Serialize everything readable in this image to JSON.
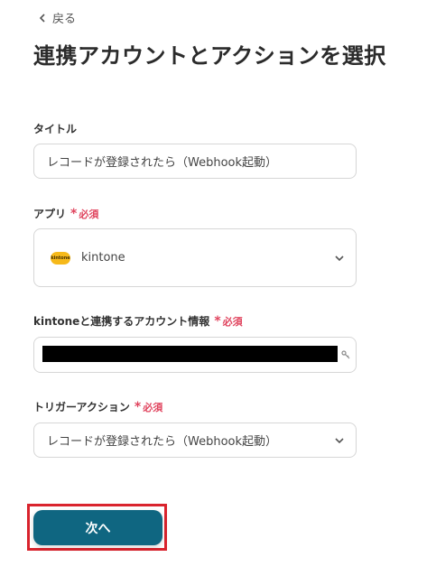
{
  "nav": {
    "back_label": "戻る"
  },
  "page": {
    "title": "連携アカウントとアクションを選択"
  },
  "fields": {
    "title": {
      "label": "タイトル",
      "value": "レコードが登録されたら（Webhook起動）"
    },
    "app": {
      "label": "アプリ",
      "required": "必須",
      "value": "kintone",
      "logo_text": "kintone"
    },
    "account": {
      "label": "kintoneと連携するアカウント情報",
      "required": "必須"
    },
    "trigger": {
      "label": "トリガーアクション",
      "required": "必須",
      "value": "レコードが登録されたら（Webhook起動）"
    }
  },
  "actions": {
    "next_label": "次へ"
  },
  "colors": {
    "accent": "#0f6681",
    "required": "#e0445e",
    "highlight": "#d9232d",
    "logo": "#f6b91a"
  }
}
